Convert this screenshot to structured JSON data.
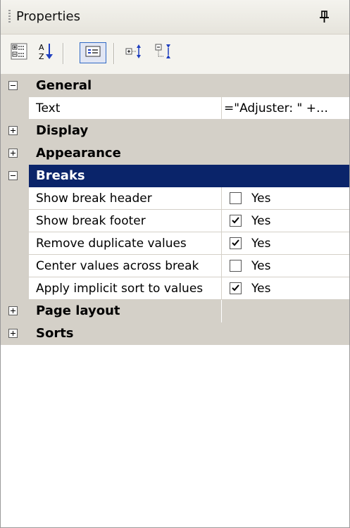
{
  "panel": {
    "title": "Properties"
  },
  "toolbar": {
    "buttons": [
      {
        "name": "categorized-view-button",
        "icon": "categorized-icon"
      },
      {
        "name": "alphabetical-view-button",
        "icon": "sort-az-icon"
      },
      {
        "name": "property-pages-button",
        "icon": "property-pages-icon",
        "active": true
      },
      {
        "name": "expand-all-button",
        "icon": "expand-all-icon"
      },
      {
        "name": "collapse-all-button",
        "icon": "collapse-all-icon"
      }
    ]
  },
  "grid": {
    "general": {
      "label": "General",
      "expanded": true
    },
    "text_prop": {
      "name": "Text",
      "value": "=\"Adjuster: \" +…"
    },
    "display": {
      "label": "Display",
      "expanded": false
    },
    "appearance": {
      "label": "Appearance",
      "expanded": false
    },
    "breaks": {
      "label": "Breaks",
      "expanded": true,
      "selected": true
    },
    "break_props": [
      {
        "name": "Show break header",
        "checked": false,
        "value": "Yes"
      },
      {
        "name": "Show break footer",
        "checked": true,
        "value": "Yes"
      },
      {
        "name": "Remove duplicate values",
        "checked": true,
        "value": "Yes"
      },
      {
        "name": "Center values across break",
        "checked": false,
        "value": "Yes"
      },
      {
        "name": "Apply implicit sort to values",
        "checked": true,
        "value": "Yes"
      }
    ],
    "page_layout": {
      "label": "Page layout",
      "expanded": false
    },
    "sorts": {
      "label": "Sorts",
      "expanded": false
    }
  },
  "colors": {
    "selection": "#0a246a",
    "category_bg": "#d4d0c8"
  }
}
